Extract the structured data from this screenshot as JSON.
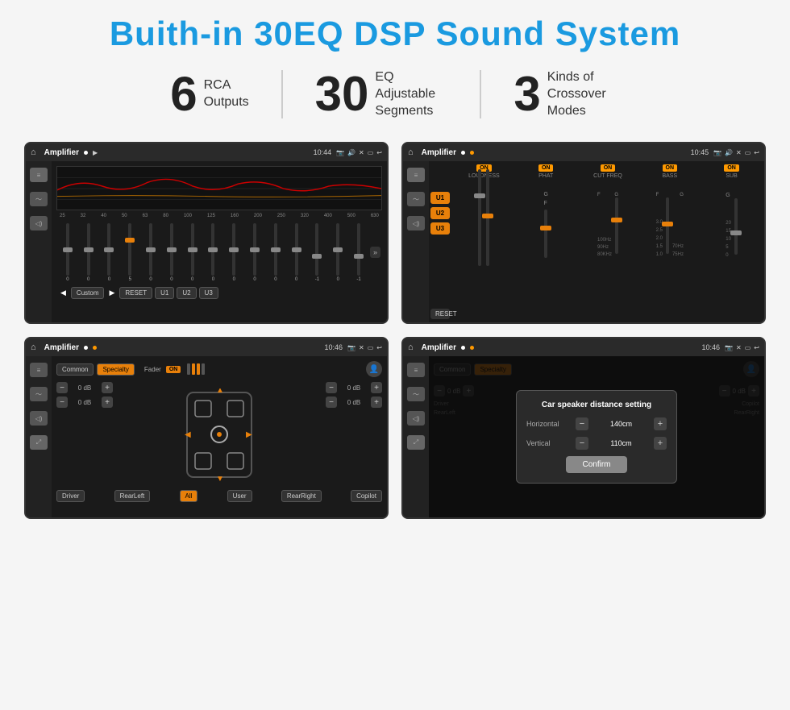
{
  "header": {
    "title": "Buith-in 30EQ DSP Sound System"
  },
  "stats": [
    {
      "number": "6",
      "label": "RCA\nOutputs"
    },
    {
      "number": "30",
      "label": "EQ Adjustable\nSegments"
    },
    {
      "number": "3",
      "label": "Kinds of\nCrossover Modes"
    }
  ],
  "screens": [
    {
      "id": "screen1",
      "topbar": {
        "app": "Amplifier",
        "time": "10:44"
      },
      "type": "eq-main",
      "description": "30-band EQ with Custom/Reset/U1/U2/U3"
    },
    {
      "id": "screen2",
      "topbar": {
        "app": "Amplifier",
        "time": "10:45"
      },
      "type": "eq-u-selector",
      "description": "EQ with U1/U2/U3 and LOUDNESS/PHAT/CUT FREQ/BASS/SUB"
    },
    {
      "id": "screen3",
      "topbar": {
        "app": "Amplifier",
        "time": "10:46"
      },
      "type": "fader-car",
      "description": "Common/Specialty with car fader diagram"
    },
    {
      "id": "screen4",
      "topbar": {
        "app": "Amplifier",
        "time": "10:46"
      },
      "type": "distance-dialog",
      "description": "Car speaker distance setting dialog"
    }
  ],
  "eq_screen": {
    "freq_labels": [
      "25",
      "32",
      "40",
      "50",
      "63",
      "80",
      "100",
      "125",
      "160",
      "200",
      "250",
      "320",
      "400",
      "500",
      "630"
    ],
    "slider_values": [
      "0",
      "0",
      "0",
      "5",
      "0",
      "0",
      "0",
      "0",
      "0",
      "0",
      "0",
      "0",
      "-1",
      "0",
      "-1"
    ],
    "buttons": [
      "Custom",
      "RESET",
      "U1",
      "U2",
      "U3"
    ]
  },
  "eq2_screen": {
    "u_buttons": [
      "U1",
      "U2",
      "U3"
    ],
    "channels": [
      "LOUDNESS",
      "PHAT",
      "CUT FREQ",
      "BASS",
      "SUB"
    ],
    "on_label": "ON",
    "reset_label": "RESET"
  },
  "fader_screen": {
    "common_label": "Common",
    "specialty_label": "Specialty",
    "fader_label": "Fader",
    "on_label": "ON",
    "db_values": [
      "0 dB",
      "0 dB",
      "0 dB",
      "0 dB"
    ],
    "position_labels": [
      "Driver",
      "RearLeft",
      "All",
      "User",
      "RearRight",
      "Copilot"
    ]
  },
  "dialog": {
    "title": "Car speaker distance setting",
    "horizontal_label": "Horizontal",
    "horizontal_value": "140cm",
    "vertical_label": "Vertical",
    "vertical_value": "110cm",
    "confirm_label": "Confirm"
  }
}
